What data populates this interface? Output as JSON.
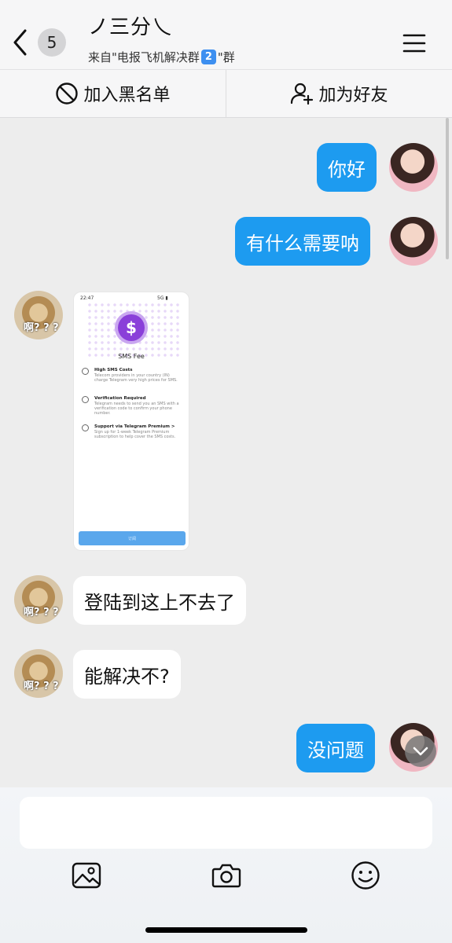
{
  "header": {
    "unread_count": "5",
    "title": "ノ三分乀",
    "subtitle_prefix": "来自\"电报飞机解决群",
    "subtitle_badge": "2",
    "subtitle_suffix": "\"群",
    "back_icon": "chevron-left-icon",
    "menu_icon": "hamburger-menu-icon"
  },
  "actions": {
    "block_label": "加入黑名单",
    "add_friend_label": "加为好友"
  },
  "messages": [
    {
      "side": "out",
      "text": "你好"
    },
    {
      "side": "out",
      "text": "有什么需要呐"
    },
    {
      "side": "in",
      "type": "image"
    },
    {
      "side": "in",
      "text": "登陆到这上不去了"
    },
    {
      "side": "in",
      "text": "能解决不?"
    },
    {
      "side": "out",
      "text": "没问题"
    }
  ],
  "avatar_caption": "啊? ? ?",
  "image_msg": {
    "status_time": "22:47",
    "status_right": "5G ▮",
    "title": "SMS Fee",
    "rows": [
      {
        "heading": "High SMS Costs",
        "body": "Telecom providers in your country (IN) charge Telegram very high prices for SMS."
      },
      {
        "heading": "Verification Required",
        "body": "Telegram needs to send you an SMS with a verification code to confirm your phone number."
      },
      {
        "heading": "Support via Telegram Premium >",
        "body": "Sign up for 1-week Telegram Premium subscription to help cover the SMS costs."
      }
    ],
    "button": "订阅"
  },
  "composer": {
    "input_value": "",
    "tools": [
      "image-icon",
      "camera-icon",
      "smile-icon"
    ]
  },
  "colors": {
    "accent": "#1d9bf0",
    "background": "#ededed"
  }
}
